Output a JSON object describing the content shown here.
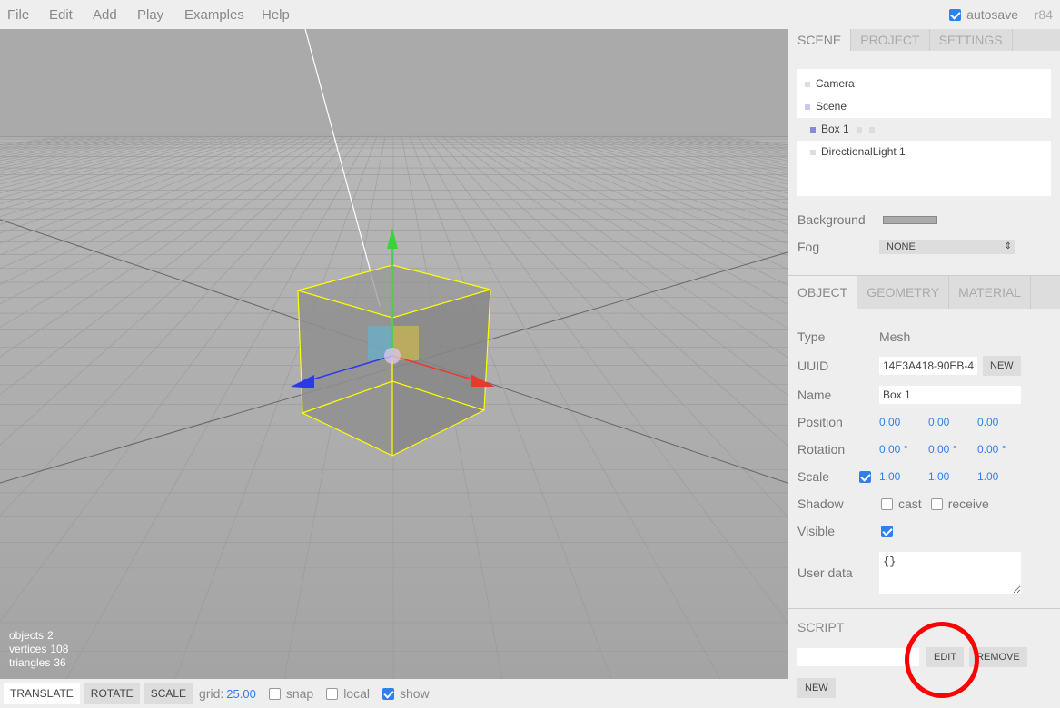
{
  "menubar": {
    "items": [
      "File",
      "Edit",
      "Add",
      "Play",
      "Examples",
      "Help"
    ],
    "autosave_label": "autosave",
    "autosave_checked": true,
    "revision": "r84"
  },
  "viewport_info": {
    "objects_label": "objects",
    "objects_value": "2",
    "vertices_label": "vertices",
    "vertices_value": "108",
    "triangles_label": "triangles",
    "triangles_value": "36"
  },
  "toolbar": {
    "translate": "TRANSLATE",
    "rotate": "ROTATE",
    "scale": "SCALE",
    "grid_label": "grid:",
    "grid_value": "25.00",
    "snap_label": "snap",
    "local_label": "local",
    "show_label": "show"
  },
  "sidebar": {
    "scene_tabs": [
      "SCENE",
      "PROJECT",
      "SETTINGS"
    ],
    "outliner": [
      {
        "label": "Camera"
      },
      {
        "label": "Scene"
      },
      {
        "label": "Box 1"
      },
      {
        "label": "DirectionalLight 1"
      }
    ],
    "background_label": "Background",
    "fog_label": "Fog",
    "fog_value": "NONE",
    "object_tabs": [
      "OBJECT",
      "GEOMETRY",
      "MATERIAL"
    ],
    "object": {
      "type_label": "Type",
      "type_value": "Mesh",
      "uuid_label": "UUID",
      "uuid_value": "14E3A418-90EB-4",
      "uuid_new": "NEW",
      "name_label": "Name",
      "name_value": "Box 1",
      "position_label": "Position",
      "position": [
        "0.00",
        "0.00",
        "0.00"
      ],
      "rotation_label": "Rotation",
      "rotation": [
        "0.00 °",
        "0.00 °",
        "0.00 °"
      ],
      "scale_label": "Scale",
      "scale": [
        "1.00",
        "1.00",
        "1.00"
      ],
      "shadow_label": "Shadow",
      "cast_label": "cast",
      "receive_label": "receive",
      "visible_label": "Visible",
      "userdata_label": "User data",
      "userdata_value": "{}"
    },
    "script": {
      "title": "SCRIPT",
      "edit": "EDIT",
      "remove": "REMOVE",
      "new": "NEW"
    }
  },
  "colors": {
    "accent": "#2f80ed",
    "selection_box": "#ffff00",
    "annotation_circle": "#ff0000",
    "viewport_bg": "#aaaaaa"
  }
}
